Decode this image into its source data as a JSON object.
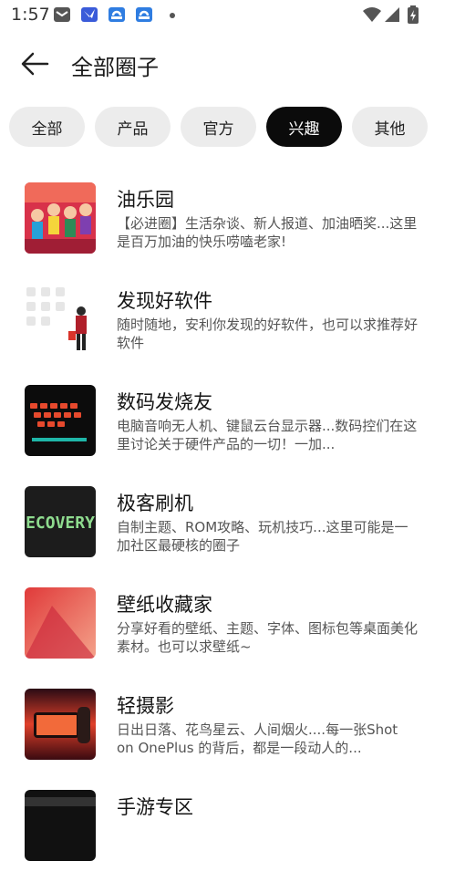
{
  "status_bar": {
    "time": "1:57",
    "icons": [
      "mail-icon",
      "app-icon",
      "app-icon",
      "app-icon",
      "wifi-icon",
      "signal-icon",
      "battery-icon"
    ]
  },
  "header": {
    "back_icon": "arrow-left-icon",
    "title": "全部圈子"
  },
  "tabs": [
    {
      "label": "全部",
      "active": false
    },
    {
      "label": "产品",
      "active": false
    },
    {
      "label": "官方",
      "active": false
    },
    {
      "label": "兴趣",
      "active": true
    },
    {
      "label": "其他",
      "active": false
    }
  ],
  "circles": [
    {
      "title": "油乐园",
      "desc": "【必进圈】生活杂谈、新人报道、加油晒奖...这里是百万加油的快乐唠嗑老家!"
    },
    {
      "title": "发现好软件",
      "desc": "随时随地，安利你发现的好软件，也可以求推荐好软件"
    },
    {
      "title": "数码发烧友",
      "desc": "电脑音响无人机、键鼠云台显示器...数码控们在这里讨论关于硬件产品的一切！一加..."
    },
    {
      "title": "极客刷机",
      "desc": "自制主题、ROM攻略、玩机技巧...这里可能是一加社区最硬核的圈子",
      "thumb_text": "ECOVERY"
    },
    {
      "title": "壁纸收藏家",
      "desc": "分享好看的壁纸、主题、字体、图标包等桌面美化素材。也可以求壁纸~"
    },
    {
      "title": "轻摄影",
      "desc": "日出日落、花鸟星云、人间烟火....每一张Shot on OnePlus 的背后，都是一段动人的..."
    },
    {
      "title": "手游专区",
      "desc": ""
    }
  ],
  "colors": {
    "active_tab": "#0b0b0b",
    "inactive_tab": "#ececec"
  }
}
